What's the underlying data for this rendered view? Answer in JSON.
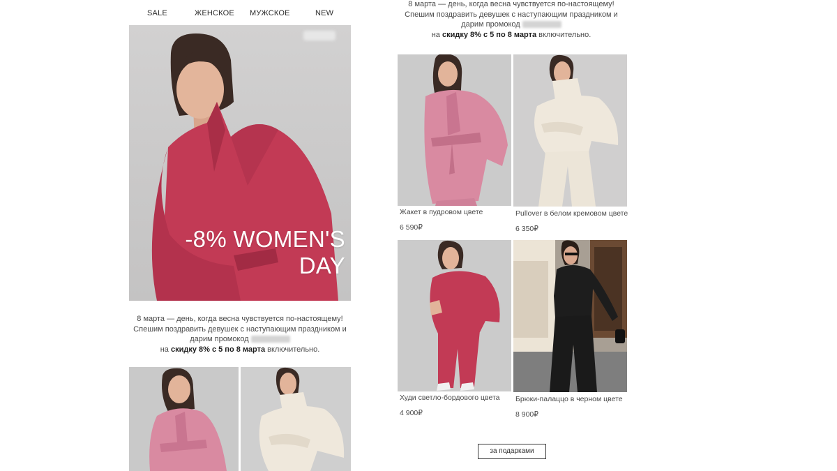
{
  "nav": {
    "sale": "SALE",
    "women": "ЖЕНСКОЕ",
    "men": "МУЖСКОЕ",
    "new": "NEW"
  },
  "hero": {
    "title_line1": "-8% WOMEN'S",
    "title_line2": "DAY"
  },
  "promo": {
    "line1": "8 марта — день, когда весна чувствуется по-настоящему!",
    "line2": "Спешим поздравить девушек с наступающим праздником и",
    "line3": "дарим промокод",
    "line4_prefix": "на",
    "line4_bold": "скидку 8% с 5 по 8 марта",
    "line4_suffix": "включительно."
  },
  "products": [
    {
      "name": "Жакет в пудровом цвете",
      "price": "6 590₽"
    },
    {
      "name": "Pullover в белом кремовом цвете",
      "price": "6 350₽"
    },
    {
      "name": "Худи светло-бордового цвета",
      "price": "4 900₽"
    },
    {
      "name": "Брюки-палаццо в черном цвете",
      "price": "8 900₽"
    }
  ],
  "cta": {
    "label": "за подарками"
  },
  "colors": {
    "burgundy": "#c23a55",
    "pink": "#d98aa1",
    "cream": "#efe8dc",
    "black": "#1d1d1d"
  }
}
